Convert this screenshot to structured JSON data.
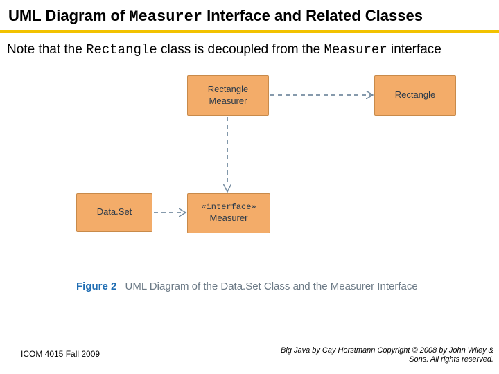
{
  "title": {
    "prefix": "UML Diagram of ",
    "code": "Measurer",
    "suffix": " Interface and Related Classes"
  },
  "note": {
    "p1": "Note that the ",
    "code1": "Rectangle",
    "p2": " class is decoupled from the ",
    "code2": "Measurer",
    "p3": " interface"
  },
  "boxes": {
    "rectmeasurer_l1": "Rectangle",
    "rectmeasurer_l2": "Measurer",
    "rectangle": "Rectangle",
    "dataset": "Data.Set",
    "measurer_stereo": "«interface»",
    "measurer_name": "Measurer"
  },
  "caption": {
    "fignum": "Figure 2",
    "text": "UML Diagram of the Data.Set Class and the Measurer Interface"
  },
  "footer": {
    "left": "ICOM 4015 Fall 2009",
    "right": "Big Java by Cay Horstmann Copyright © 2008 by John Wiley & Sons. All rights reserved."
  },
  "colors": {
    "accent_rule": "#f2c200",
    "box_fill": "#f3ac69",
    "arrow": "#758ca0",
    "fignum": "#1f6db3"
  }
}
